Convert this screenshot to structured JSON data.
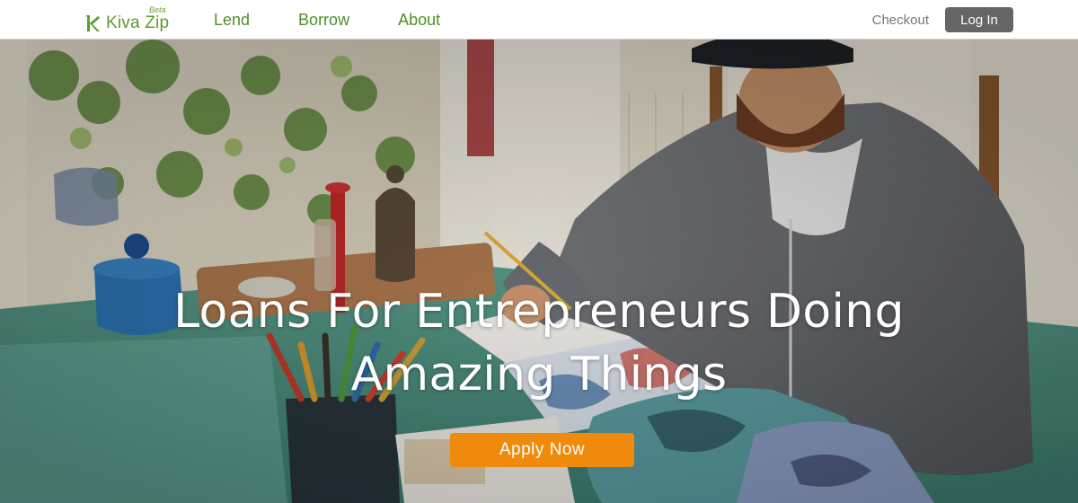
{
  "header": {
    "logo": {
      "text": "Kiva Zip",
      "badge": "Beta",
      "icon": "kiva-leaf-icon"
    },
    "nav": [
      {
        "label": "Lend"
      },
      {
        "label": "Borrow"
      },
      {
        "label": "About"
      }
    ],
    "checkout_label": "Checkout",
    "login_label": "Log In"
  },
  "hero": {
    "title_line1": "Loans For Entrepreneurs Doing",
    "title_line2": "Amazing Things",
    "cta_label": "Apply Now",
    "image": "entrepreneur-drawing-at-table-photo"
  },
  "colors": {
    "brand_green": "#5c9a2e",
    "login_bg": "#666666",
    "cta_orange": "#f08a0c",
    "nav_border": "#d6d6d6"
  }
}
